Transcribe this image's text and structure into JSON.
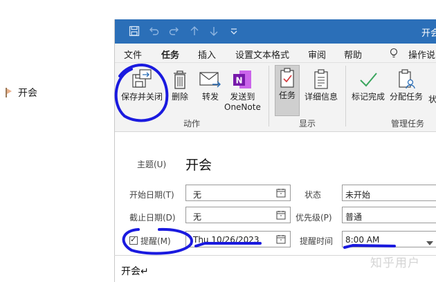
{
  "background": {
    "item_label": "开会"
  },
  "window": {
    "title": "开会",
    "tabs": [
      "文件",
      "任务",
      "插入",
      "设置文本格式",
      "审阅",
      "帮助",
      "操作说"
    ],
    "active_tab": "任务",
    "ribbon": {
      "save_close": "保存并关闭",
      "delete": "删除",
      "forward": "转发",
      "send_to_line1": "发送到",
      "send_to_line2": "OneNote",
      "task": "任务",
      "details": "详细信息",
      "mark_complete": "标记完成",
      "assign_task": "分配任务",
      "more_cut": "状",
      "group_actions": "动作",
      "group_show": "显示",
      "group_manage": "管理任务"
    }
  },
  "form": {
    "subject_label": "主题(U)",
    "subject_value": "开会",
    "start_label": "开始日期(T)",
    "start_value": "无",
    "due_label": "截止日期(D)",
    "due_value": "无",
    "status_label": "状态",
    "status_value": "未开始",
    "priority_label": "优先级(P)",
    "priority_value": "普通",
    "reminder_label": "提醒(M)",
    "reminder_checked": true,
    "reminder_date": "Thu 10/26/2023",
    "reminder_time_label": "提醒时间",
    "reminder_time": "8:00 AM",
    "body_text": "开会↵"
  },
  "watermark": "知乎用户",
  "colors": {
    "accent": "#2b6fb8",
    "annotation": "#1a1adf"
  }
}
